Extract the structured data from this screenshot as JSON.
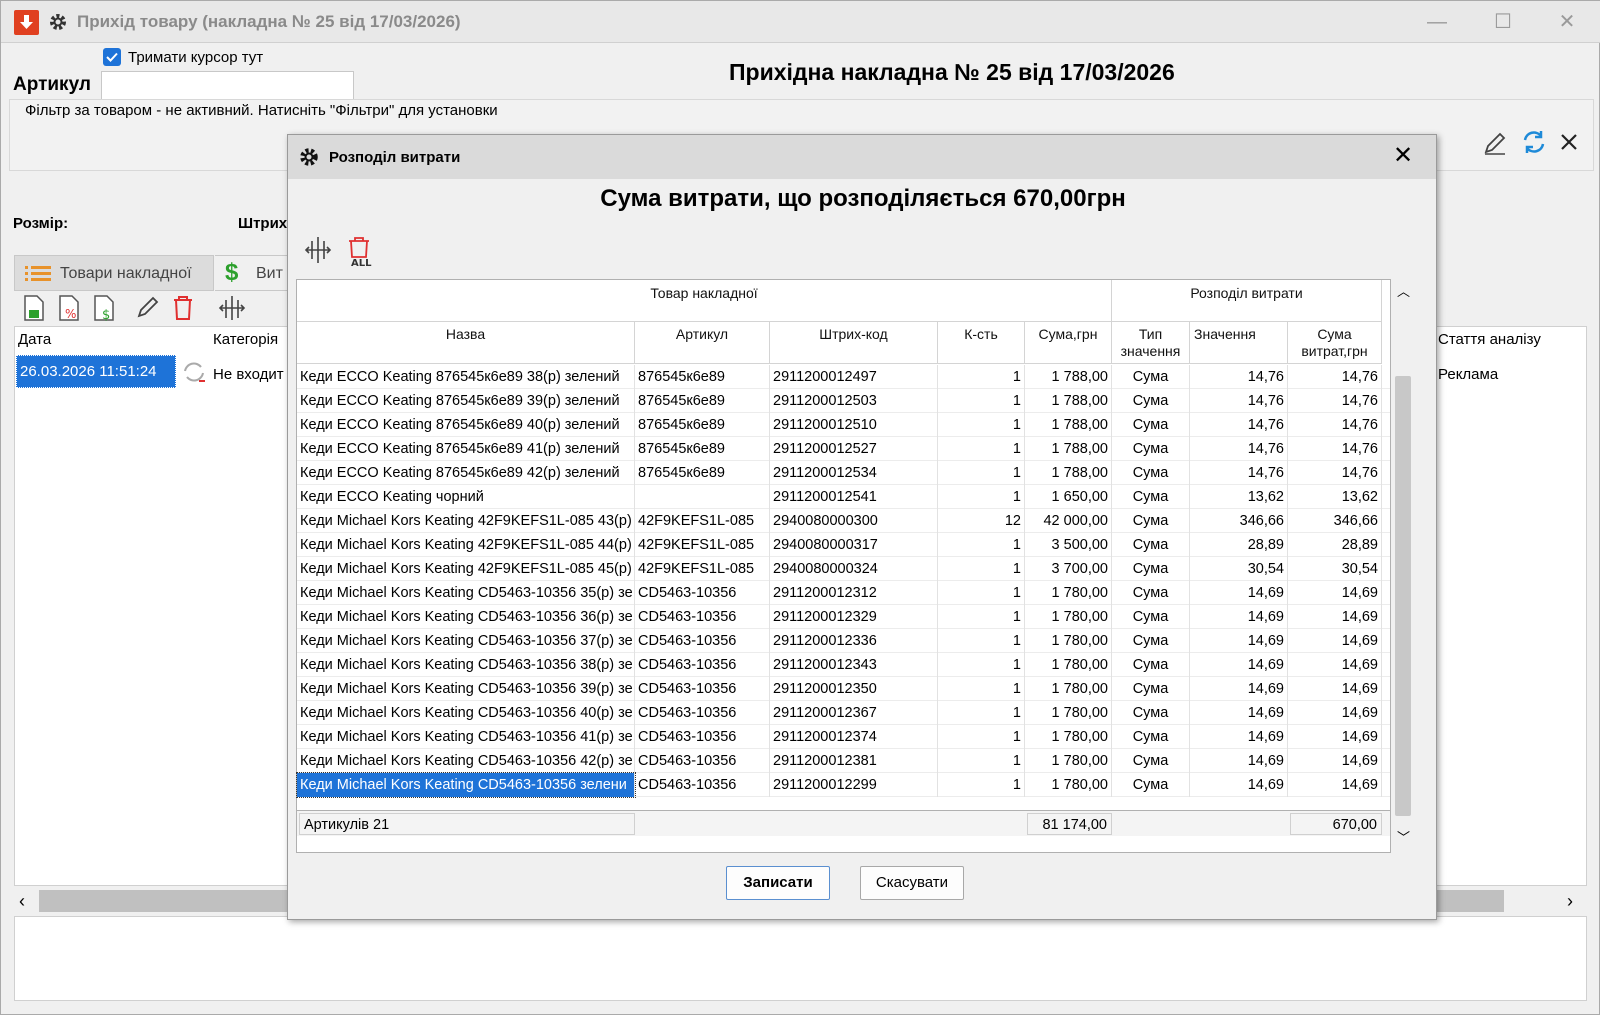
{
  "window": {
    "title": "Прихід товару (накладна № 25 від 17/03/2026)",
    "hold_cursor_label": "Тримати курсор тут",
    "artikul_label": "Артикул",
    "artikul_value": "",
    "heading": "Прихідна накладна № 25 від 17/03/2026",
    "filter_text": "Фільтр за товаром - не активний. Натисніть \"Фільтри\" для установки",
    "size_label": "Розмір:",
    "barcode_label": "Штрих",
    "tabs": [
      {
        "label": "Товари накладної"
      },
      {
        "label": "Вит"
      }
    ],
    "bg_grid": {
      "col_date": "Дата",
      "col_category": "Категорія",
      "col_analysis": "Стаття аналізу",
      "row_date": "26.03.2026 11:51:24",
      "row_category": "Не входит",
      "row_analysis": "Реклама"
    }
  },
  "dialog": {
    "title": "Розподіл витрати",
    "heading": "Сума витрати, що розподіляється 670,00грн",
    "group_goods": "Товар накладної",
    "group_distribution": "Розподіл витрати",
    "columns": {
      "name": "Назва",
      "artikul": "Артикул",
      "barcode": "Штрих-код",
      "qty": "К-сть",
      "sum": "Сума,грн",
      "type_line1": "Тип",
      "type_line2": "значення",
      "value": "Значення",
      "cost_line1": "Сума",
      "cost_line2": "витрат,грн"
    },
    "rows": [
      {
        "name": "Кеди ECCO Keating 876545к6е89 38(р) зелений",
        "artikul": "876545к6е89",
        "barcode": "2911200012497",
        "qty": "1",
        "sum": "1 788,00",
        "type": "Сума",
        "value": "14,76",
        "cost": "14,76"
      },
      {
        "name": "Кеди ECCO Keating 876545к6е89 39(р) зелений",
        "artikul": "876545к6е89",
        "barcode": "2911200012503",
        "qty": "1",
        "sum": "1 788,00",
        "type": "Сума",
        "value": "14,76",
        "cost": "14,76"
      },
      {
        "name": "Кеди ECCO Keating 876545к6е89 40(р) зелений",
        "artikul": "876545к6е89",
        "barcode": "2911200012510",
        "qty": "1",
        "sum": "1 788,00",
        "type": "Сума",
        "value": "14,76",
        "cost": "14,76"
      },
      {
        "name": "Кеди ECCO Keating 876545к6е89 41(р) зелений",
        "artikul": "876545к6е89",
        "barcode": "2911200012527",
        "qty": "1",
        "sum": "1 788,00",
        "type": "Сума",
        "value": "14,76",
        "cost": "14,76"
      },
      {
        "name": "Кеди ECCO Keating 876545к6е89 42(р) зелений",
        "artikul": "876545к6е89",
        "barcode": "2911200012534",
        "qty": "1",
        "sum": "1 788,00",
        "type": "Сума",
        "value": "14,76",
        "cost": "14,76"
      },
      {
        "name": "Кеди ECCO Keating чорний",
        "artikul": "",
        "barcode": "2911200012541",
        "qty": "1",
        "sum": "1 650,00",
        "type": "Сума",
        "value": "13,62",
        "cost": "13,62"
      },
      {
        "name": "Кеди Michael Kors Keating 42F9KEFS1L-085 43(р)",
        "artikul": "42F9KEFS1L-085",
        "barcode": "2940080000300",
        "qty": "12",
        "sum": "42 000,00",
        "type": "Сума",
        "value": "346,66",
        "cost": "346,66"
      },
      {
        "name": "Кеди Michael Kors Keating 42F9KEFS1L-085 44(р)",
        "artikul": "42F9KEFS1L-085",
        "barcode": "2940080000317",
        "qty": "1",
        "sum": "3 500,00",
        "type": "Сума",
        "value": "28,89",
        "cost": "28,89"
      },
      {
        "name": "Кеди Michael Kors Keating 42F9KEFS1L-085 45(р)",
        "artikul": "42F9KEFS1L-085",
        "barcode": "2940080000324",
        "qty": "1",
        "sum": "3 700,00",
        "type": "Сума",
        "value": "30,54",
        "cost": "30,54"
      },
      {
        "name": "Кеди Michael Kors Keating CD5463-10356 35(р) зе",
        "artikul": "CD5463-10356",
        "barcode": "2911200012312",
        "qty": "1",
        "sum": "1 780,00",
        "type": "Сума",
        "value": "14,69",
        "cost": "14,69"
      },
      {
        "name": "Кеди Michael Kors Keating CD5463-10356 36(р) зе",
        "artikul": "CD5463-10356",
        "barcode": "2911200012329",
        "qty": "1",
        "sum": "1 780,00",
        "type": "Сума",
        "value": "14,69",
        "cost": "14,69"
      },
      {
        "name": "Кеди Michael Kors Keating CD5463-10356 37(р) зе",
        "artikul": "CD5463-10356",
        "barcode": "2911200012336",
        "qty": "1",
        "sum": "1 780,00",
        "type": "Сума",
        "value": "14,69",
        "cost": "14,69"
      },
      {
        "name": "Кеди Michael Kors Keating CD5463-10356 38(р) зе",
        "artikul": "CD5463-10356",
        "barcode": "2911200012343",
        "qty": "1",
        "sum": "1 780,00",
        "type": "Сума",
        "value": "14,69",
        "cost": "14,69"
      },
      {
        "name": "Кеди Michael Kors Keating CD5463-10356 39(р) зе",
        "artikul": "CD5463-10356",
        "barcode": "2911200012350",
        "qty": "1",
        "sum": "1 780,00",
        "type": "Сума",
        "value": "14,69",
        "cost": "14,69"
      },
      {
        "name": "Кеди Michael Kors Keating CD5463-10356 40(р) зе",
        "artikul": "CD5463-10356",
        "barcode": "2911200012367",
        "qty": "1",
        "sum": "1 780,00",
        "type": "Сума",
        "value": "14,69",
        "cost": "14,69"
      },
      {
        "name": "Кеди Michael Kors Keating CD5463-10356 41(р) зе",
        "artikul": "CD5463-10356",
        "barcode": "2911200012374",
        "qty": "1",
        "sum": "1 780,00",
        "type": "Сума",
        "value": "14,69",
        "cost": "14,69"
      },
      {
        "name": "Кеди Michael Kors Keating CD5463-10356 42(р) зе",
        "artikul": "CD5463-10356",
        "barcode": "2911200012381",
        "qty": "1",
        "sum": "1 780,00",
        "type": "Сума",
        "value": "14,69",
        "cost": "14,69"
      },
      {
        "name": "Кеди Michael Kors Keating CD5463-10356 зелени",
        "artikul": "CD5463-10356",
        "barcode": "2911200012299",
        "qty": "1",
        "sum": "1 780,00",
        "type": "Сума",
        "value": "14,69",
        "cost": "14,69",
        "selected": true
      }
    ],
    "footer": {
      "count_label": "Артикулів 21",
      "sum_total": "81 174,00",
      "cost_total": "670,00"
    },
    "buttons": {
      "save": "Записати",
      "cancel": "Скасувати"
    }
  },
  "colors": {
    "selection": "#1e73d8",
    "app_icon": "#e04020",
    "delete_icon": "#e03030",
    "refresh_icon": "#1e8ad8",
    "money_icon": "#2ca02c"
  }
}
